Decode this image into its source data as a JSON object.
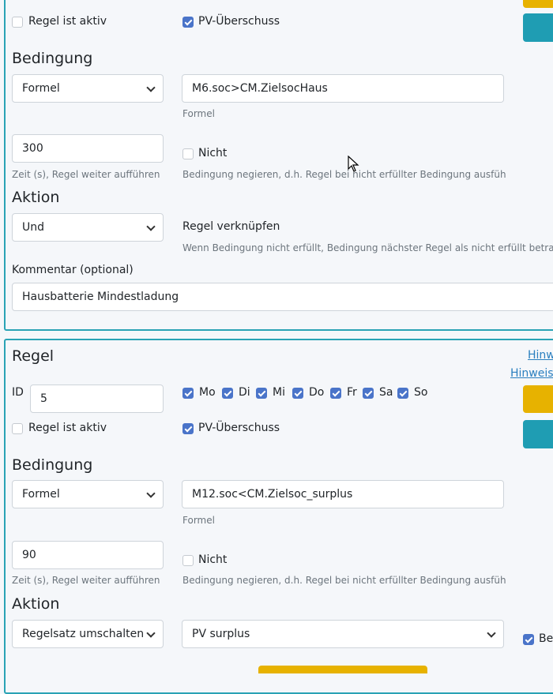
{
  "rule1": {
    "active_label": "Regel ist aktiv",
    "active_checked": false,
    "pv_label": "PV-Überschuss",
    "pv_checked": true,
    "condition_title": "Bedingung",
    "condition_type": "Formel",
    "formula_value": "M6.soc>CM.ZielsocHaus",
    "formula_help": "Formel",
    "time_value": "300",
    "time_help": "Zeit (s), Regel weiter aufführen ...",
    "not_label": "Nicht",
    "not_checked": false,
    "not_help": "Bedingung negieren, d.h. Regel bei nicht erfüllter Bedingung ausführ...",
    "action_title": "Aktion",
    "action_type": "Und",
    "link_label": "Regel verknüpfen",
    "link_help": "Wenn Bedingung nicht erfüllt, Bedingung nächster Regel als nicht erfüllt betracht",
    "comment_label": "Kommentar (optional)",
    "comment_value": "Hausbatterie Mindestladung"
  },
  "rule2": {
    "title": "Regel",
    "hint_link_1": "Hinw",
    "hint_link_2": "Hinweise",
    "id_label": "ID",
    "id_value": "5",
    "days": [
      {
        "label": "Mo",
        "checked": true
      },
      {
        "label": "Di",
        "checked": true
      },
      {
        "label": "Mi",
        "checked": true
      },
      {
        "label": "Do",
        "checked": true
      },
      {
        "label": "Fr",
        "checked": true
      },
      {
        "label": "Sa",
        "checked": true
      },
      {
        "label": "So",
        "checked": true
      }
    ],
    "active_label": "Regel ist aktiv",
    "active_checked": false,
    "pv_label": "PV-Überschuss",
    "pv_checked": true,
    "condition_title": "Bedingung",
    "condition_type": "Formel",
    "formula_value": "M12.soc<CM.Zielsoc_surplus",
    "formula_help": "Formel",
    "time_value": "90",
    "time_help": "Zeit (s), Regel weiter aufführen ...",
    "not_label": "Nicht",
    "not_checked": false,
    "not_help": "Bedingung negieren, d.h. Regel bei nicht erfüllter Bedingung ausführ...",
    "action_title": "Aktion",
    "action_type": "Regelsatz umschalten",
    "ruleset_value": "PV surplus",
    "right_check_label": "Bec",
    "right_check_checked": true
  },
  "colors": {
    "border": "#2aa3b5",
    "checkbox": "#4a74c9",
    "yellow_button": "#e7b200",
    "teal_button": "#1f9db3",
    "link": "#2a7fbf"
  }
}
